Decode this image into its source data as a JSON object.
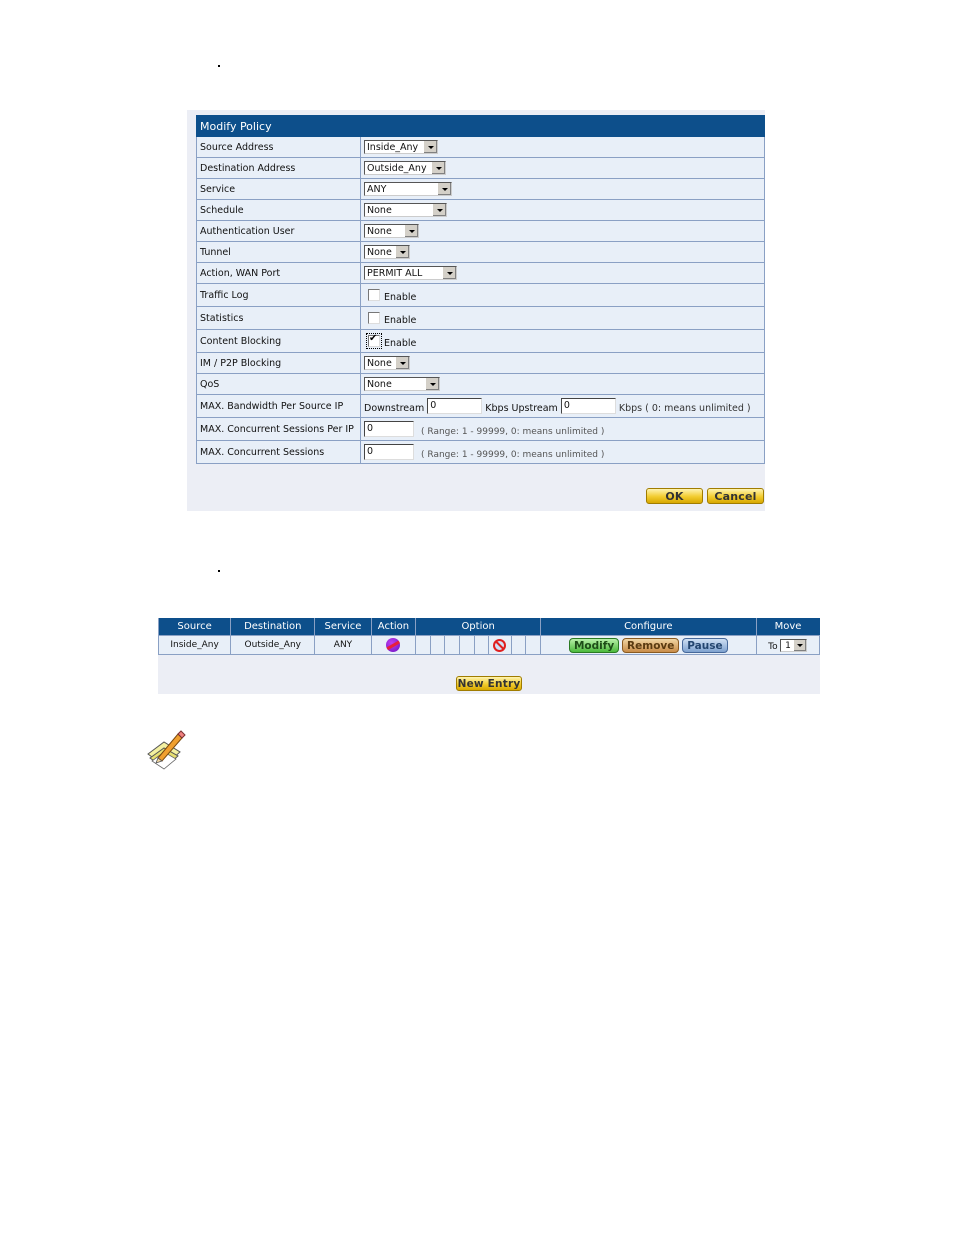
{
  "modify_policy": {
    "title": "Modify Policy",
    "rows": [
      {
        "label": "Source Address",
        "type": "select",
        "value": "Inside_Any"
      },
      {
        "label": "Destination Address",
        "type": "select",
        "value": "Outside_Any"
      },
      {
        "label": "Service",
        "type": "select",
        "value": "ANY"
      },
      {
        "label": "Schedule",
        "type": "select",
        "value": "None"
      },
      {
        "label": "Authentication User",
        "type": "select",
        "value": "None"
      },
      {
        "label": "Tunnel",
        "type": "select",
        "value": "None"
      },
      {
        "label": "Action, WAN Port",
        "type": "select",
        "value": "PERMIT ALL"
      },
      {
        "label": "Traffic Log",
        "type": "checkbox",
        "checked": false,
        "text": "Enable"
      },
      {
        "label": "Statistics",
        "type": "checkbox",
        "checked": false,
        "text": "Enable"
      },
      {
        "label": "Content Blocking",
        "type": "checkbox",
        "checked": true,
        "text": "Enable"
      },
      {
        "label": "IM / P2P Blocking",
        "type": "select",
        "value": "None"
      },
      {
        "label": "QoS",
        "type": "select",
        "value": "None"
      }
    ],
    "bandwidth": {
      "label": "MAX. Bandwidth Per Source IP",
      "downstream_label": "Downstream",
      "downstream_value": "0",
      "upstream_label": "Kbps Upstream",
      "upstream_value": "0",
      "suffix": "Kbps ( 0: means unlimited )"
    },
    "sessions_per_ip": {
      "label": "MAX. Concurrent Sessions Per IP",
      "value": "0",
      "hint": "( Range: 1 - 99999, 0: means unlimited )"
    },
    "sessions": {
      "label": "MAX. Concurrent Sessions",
      "value": "0",
      "hint": "( Range: 1 - 99999, 0: means unlimited )"
    },
    "ok_label": "OK",
    "cancel_label": "Cancel"
  },
  "policy_list": {
    "headers": [
      "Source",
      "Destination",
      "Service",
      "Action",
      "Option",
      "Configure",
      "Move"
    ],
    "rows": [
      {
        "source": "Inside_Any",
        "destination": "Outside_Any",
        "service": "ANY",
        "action_icon": "permit-all-icon",
        "option_icon": "content-blocking-icon",
        "modify_label": "Modify",
        "remove_label": "Remove",
        "pause_label": "Pause",
        "move_to_label": "To",
        "move_value": "1"
      }
    ],
    "new_entry_label": "New Entry"
  },
  "note_icon": "note-pencil-icon"
}
